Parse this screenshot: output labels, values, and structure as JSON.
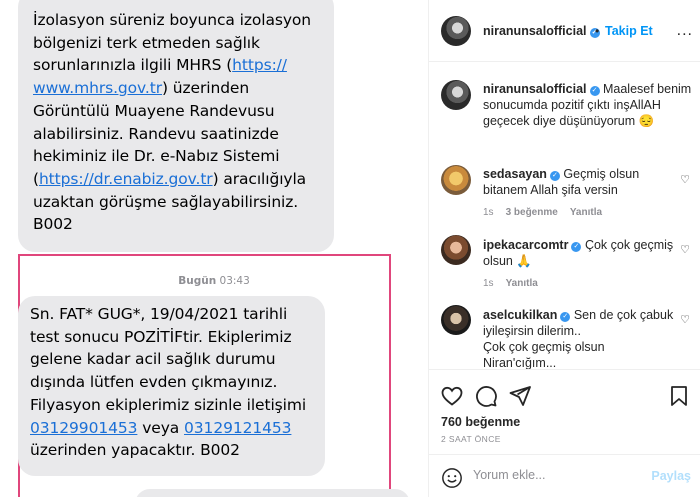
{
  "sms": {
    "bubble1_lines": [
      [
        {
          "t": "İzolasyon süreniz boyunca izolasyon"
        }
      ],
      [
        {
          "t": "bölgenizi terk etmeden sağlık"
        }
      ],
      [
        {
          "t": "sorunlarınızla ilgili MHRS ("
        },
        {
          "t": "https://",
          "link": true
        }
      ],
      [
        {
          "t": "www.mhrs.gov.tr",
          "link": true
        },
        {
          "t": ") üzerinden"
        }
      ],
      [
        {
          "t": "Görüntülü Muayene Randevusu"
        }
      ],
      [
        {
          "t": "alabilirsiniz. Randevu saatinizde"
        }
      ],
      [
        {
          "t": "hekiminiz ile Dr. e-Nabız Sistemi"
        }
      ],
      [
        {
          "t": "("
        },
        {
          "t": "https://dr.enabiz.gov.tr",
          "link": true
        },
        {
          "t": ") aracılığıyla"
        }
      ],
      [
        {
          "t": "uzaktan görüşme sağlayabilirsiniz."
        }
      ],
      [
        {
          "t": "B002"
        }
      ]
    ],
    "date_day": "Bugün",
    "date_time": "03:43",
    "bubble2_lines": [
      [
        {
          "t": "Sn. FAT* GUG*, 19/04/2021 tarihli"
        }
      ],
      [
        {
          "t": "test sonucu POZİTİFtir. Ekiplerimiz"
        }
      ],
      [
        {
          "t": "gelene kadar acil sağlık durumu"
        }
      ],
      [
        {
          "t": "dışında lütfen evden çıkmayınız."
        }
      ],
      [
        {
          "t": "Filyasyon ekiplerimiz sizinle iletişimi"
        }
      ],
      [
        {
          "t": "03129901453",
          "link": true
        },
        {
          "t": " veya "
        },
        {
          "t": "03129121453",
          "link": true
        }
      ],
      [
        {
          "t": "üzerinden yapacaktır. B002"
        }
      ]
    ],
    "highlight_color": "#e0467c",
    "link_color": "#1a6fd6",
    "bubble_color": "#e9e9eb"
  },
  "ig": {
    "header": {
      "username": "niranunsalofficial",
      "separator": "•",
      "follow_label": "Takip Et",
      "more_label": "..."
    },
    "caption": {
      "username": "niranunsalofficial",
      "lines": [
        "Maalesef benim",
        "sonucumda pozitif çıktı inşAllAH",
        "geçecek diye düşünüyorum 😔"
      ]
    },
    "comments": [
      {
        "username": "sedasayan",
        "lines": [
          "Geçmiş olsun",
          "bitanem Allah şifa versin"
        ],
        "age": "1s",
        "likes": "3 beğenme",
        "reply": "Yanıtla"
      },
      {
        "username": "ipekacarcomtr",
        "lines": [
          "Çok çok geçmiş",
          "olsun 🙏"
        ],
        "age": "1s",
        "likes": "",
        "reply": "Yanıtla"
      },
      {
        "username": "aselcukilkan",
        "lines": [
          "Sen de çok çabuk",
          "iyileşirsin dilerim..",
          "Çok çok geçmiş olsun",
          "Niran'cığım..."
        ],
        "age": "",
        "likes": "",
        "reply": ""
      }
    ],
    "likes_text": "760 beğenme",
    "time_text": "2 SAAT ÖNCE",
    "comment_placeholder": "Yorum ekle...",
    "share_label": "Paylaş",
    "accent_color": "#0095f6",
    "verified_color": "#3897f0"
  }
}
